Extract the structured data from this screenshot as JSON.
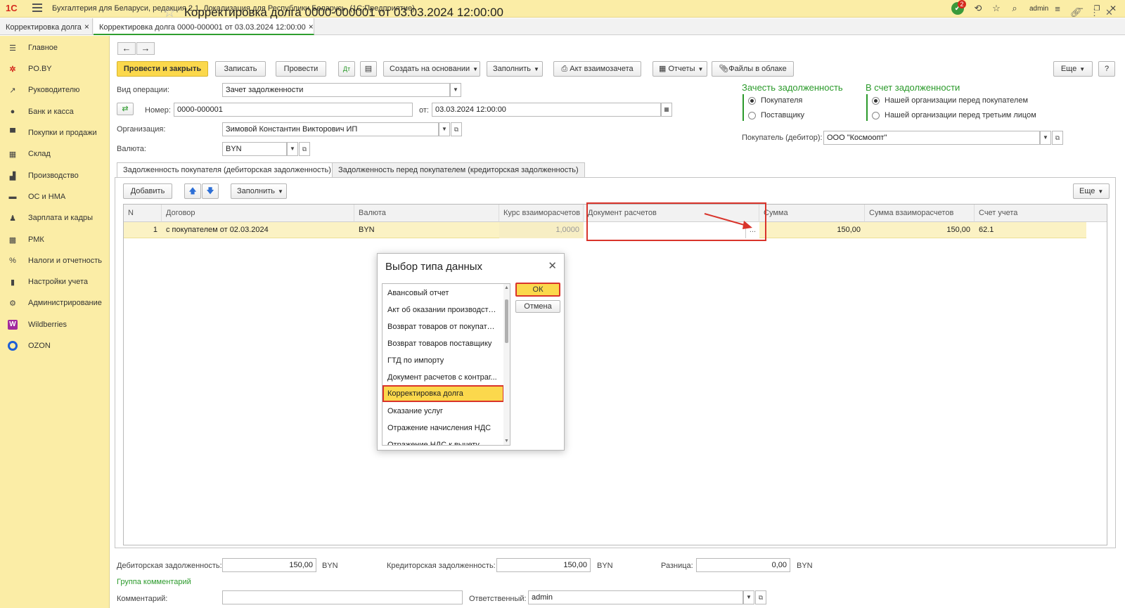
{
  "titlebar": {
    "logo": "1С",
    "title": "Бухгалтерия для Беларуси, редакция 2.1. Локализация для Республики Беларусь",
    "platform": "(1С:Предприятие)",
    "notif_count": "2",
    "user": "admin"
  },
  "tabs": [
    {
      "label": "Корректировка долга"
    },
    {
      "label": "Корректировка долга 0000-000001 от 03.03.2024 12:00:00"
    }
  ],
  "sidebar": {
    "items": [
      {
        "label": "Главное"
      },
      {
        "label": "PO.BY"
      },
      {
        "label": "Руководителю"
      },
      {
        "label": "Банк и касса"
      },
      {
        "label": "Покупки и продажи"
      },
      {
        "label": "Склад"
      },
      {
        "label": "Производство"
      },
      {
        "label": "ОС и НМА"
      },
      {
        "label": "Зарплата и кадры"
      },
      {
        "label": "РМК"
      },
      {
        "label": "Налоги и отчетность"
      },
      {
        "label": "Настройки учета"
      },
      {
        "label": "Администрирование"
      },
      {
        "label": "Wildberries"
      },
      {
        "label": "OZON"
      }
    ]
  },
  "form": {
    "title": "Корректировка долга 0000-000001 от 03.03.2024 12:00:00",
    "toolbar": {
      "post_close": "Провести и закрыть",
      "save": "Записать",
      "post": "Провести",
      "create_based": "Создать на основании",
      "fill": "Заполнить",
      "offset_act": "Акт взаимозачета",
      "reports": "Отчеты",
      "cloud_files": "Файлы в облаке",
      "more": "Еще",
      "help": "?"
    },
    "operation_label": "Вид операции:",
    "operation_value": "Зачет задолженности",
    "number_label": "Номер:",
    "number_value": "0000-000001",
    "date_label": "от:",
    "date_value": "03.03.2024 12:00:00",
    "org_label": "Организация:",
    "org_value": "Зимовой Константин Викторович ИП",
    "currency_label": "Валюта:",
    "currency_value": "BYN",
    "offset_group": {
      "title": "Зачесть задолженность",
      "options": [
        "Покупателя",
        "Поставщику"
      ]
    },
    "account_group": {
      "title": "В счет задолженности",
      "options": [
        "Нашей организации перед покупателем",
        "Нашей организации перед третьим лицом"
      ]
    },
    "buyer_label": "Покупатель (дебитор):",
    "buyer_value": "ООО \"Космоопт\""
  },
  "page_tabs": [
    {
      "label": "Задолженность покупателя (дебиторская задолженность)"
    },
    {
      "label": "Задолженность перед покупателем (кредиторская задолженность)"
    }
  ],
  "table": {
    "add": "Добавить",
    "fill": "Заполнить",
    "more": "Еще",
    "columns": [
      "N",
      "Договор",
      "Валюта",
      "Курс взаиморасчетов",
      "Документ расчетов",
      "Сумма",
      "Сумма взаиморасчетов",
      "Счет учета"
    ],
    "rows": [
      {
        "n": "1",
        "contract": "с покупателем от 02.03.2024",
        "currency": "BYN",
        "rate": "1,0000",
        "doc": "",
        "doc_btn": "...",
        "sum": "150,00",
        "sum_settle": "150,00",
        "account": "62.1"
      }
    ]
  },
  "totals": {
    "debit_label": "Дебиторская задолженность:",
    "debit_value": "150,00",
    "debit_cur": "BYN",
    "credit_label": "Кредиторская задолженность:",
    "credit_value": "150,00",
    "credit_cur": "BYN",
    "diff_label": "Разница:",
    "diff_value": "0,00",
    "diff_cur": "BYN"
  },
  "comments_group": "Группа комментарий",
  "comment_label": "Комментарий:",
  "comment_value": "",
  "responsible_label": "Ответственный:",
  "responsible_value": "admin",
  "dialog": {
    "title": "Выбор типа данных",
    "ok": "ОК",
    "cancel": "Отмена",
    "items": [
      "Авансовый отчет",
      "Акт об оказании производств...",
      "Возврат товаров от покупателя",
      "Возврат товаров поставщику",
      "ГТД по импорту",
      "Документ расчетов с контраг...",
      "Корректировка долга",
      "Оказание услуг",
      "Отражение начисления НДС",
      "Отражение НДС к вычету"
    ],
    "selected_index": 6
  },
  "colors": {
    "accent_yellow": "#fbd84c",
    "sidebar_bg": "#fbeda6",
    "highlight_red": "#d9342b",
    "group_green": "#2b9a2b"
  }
}
